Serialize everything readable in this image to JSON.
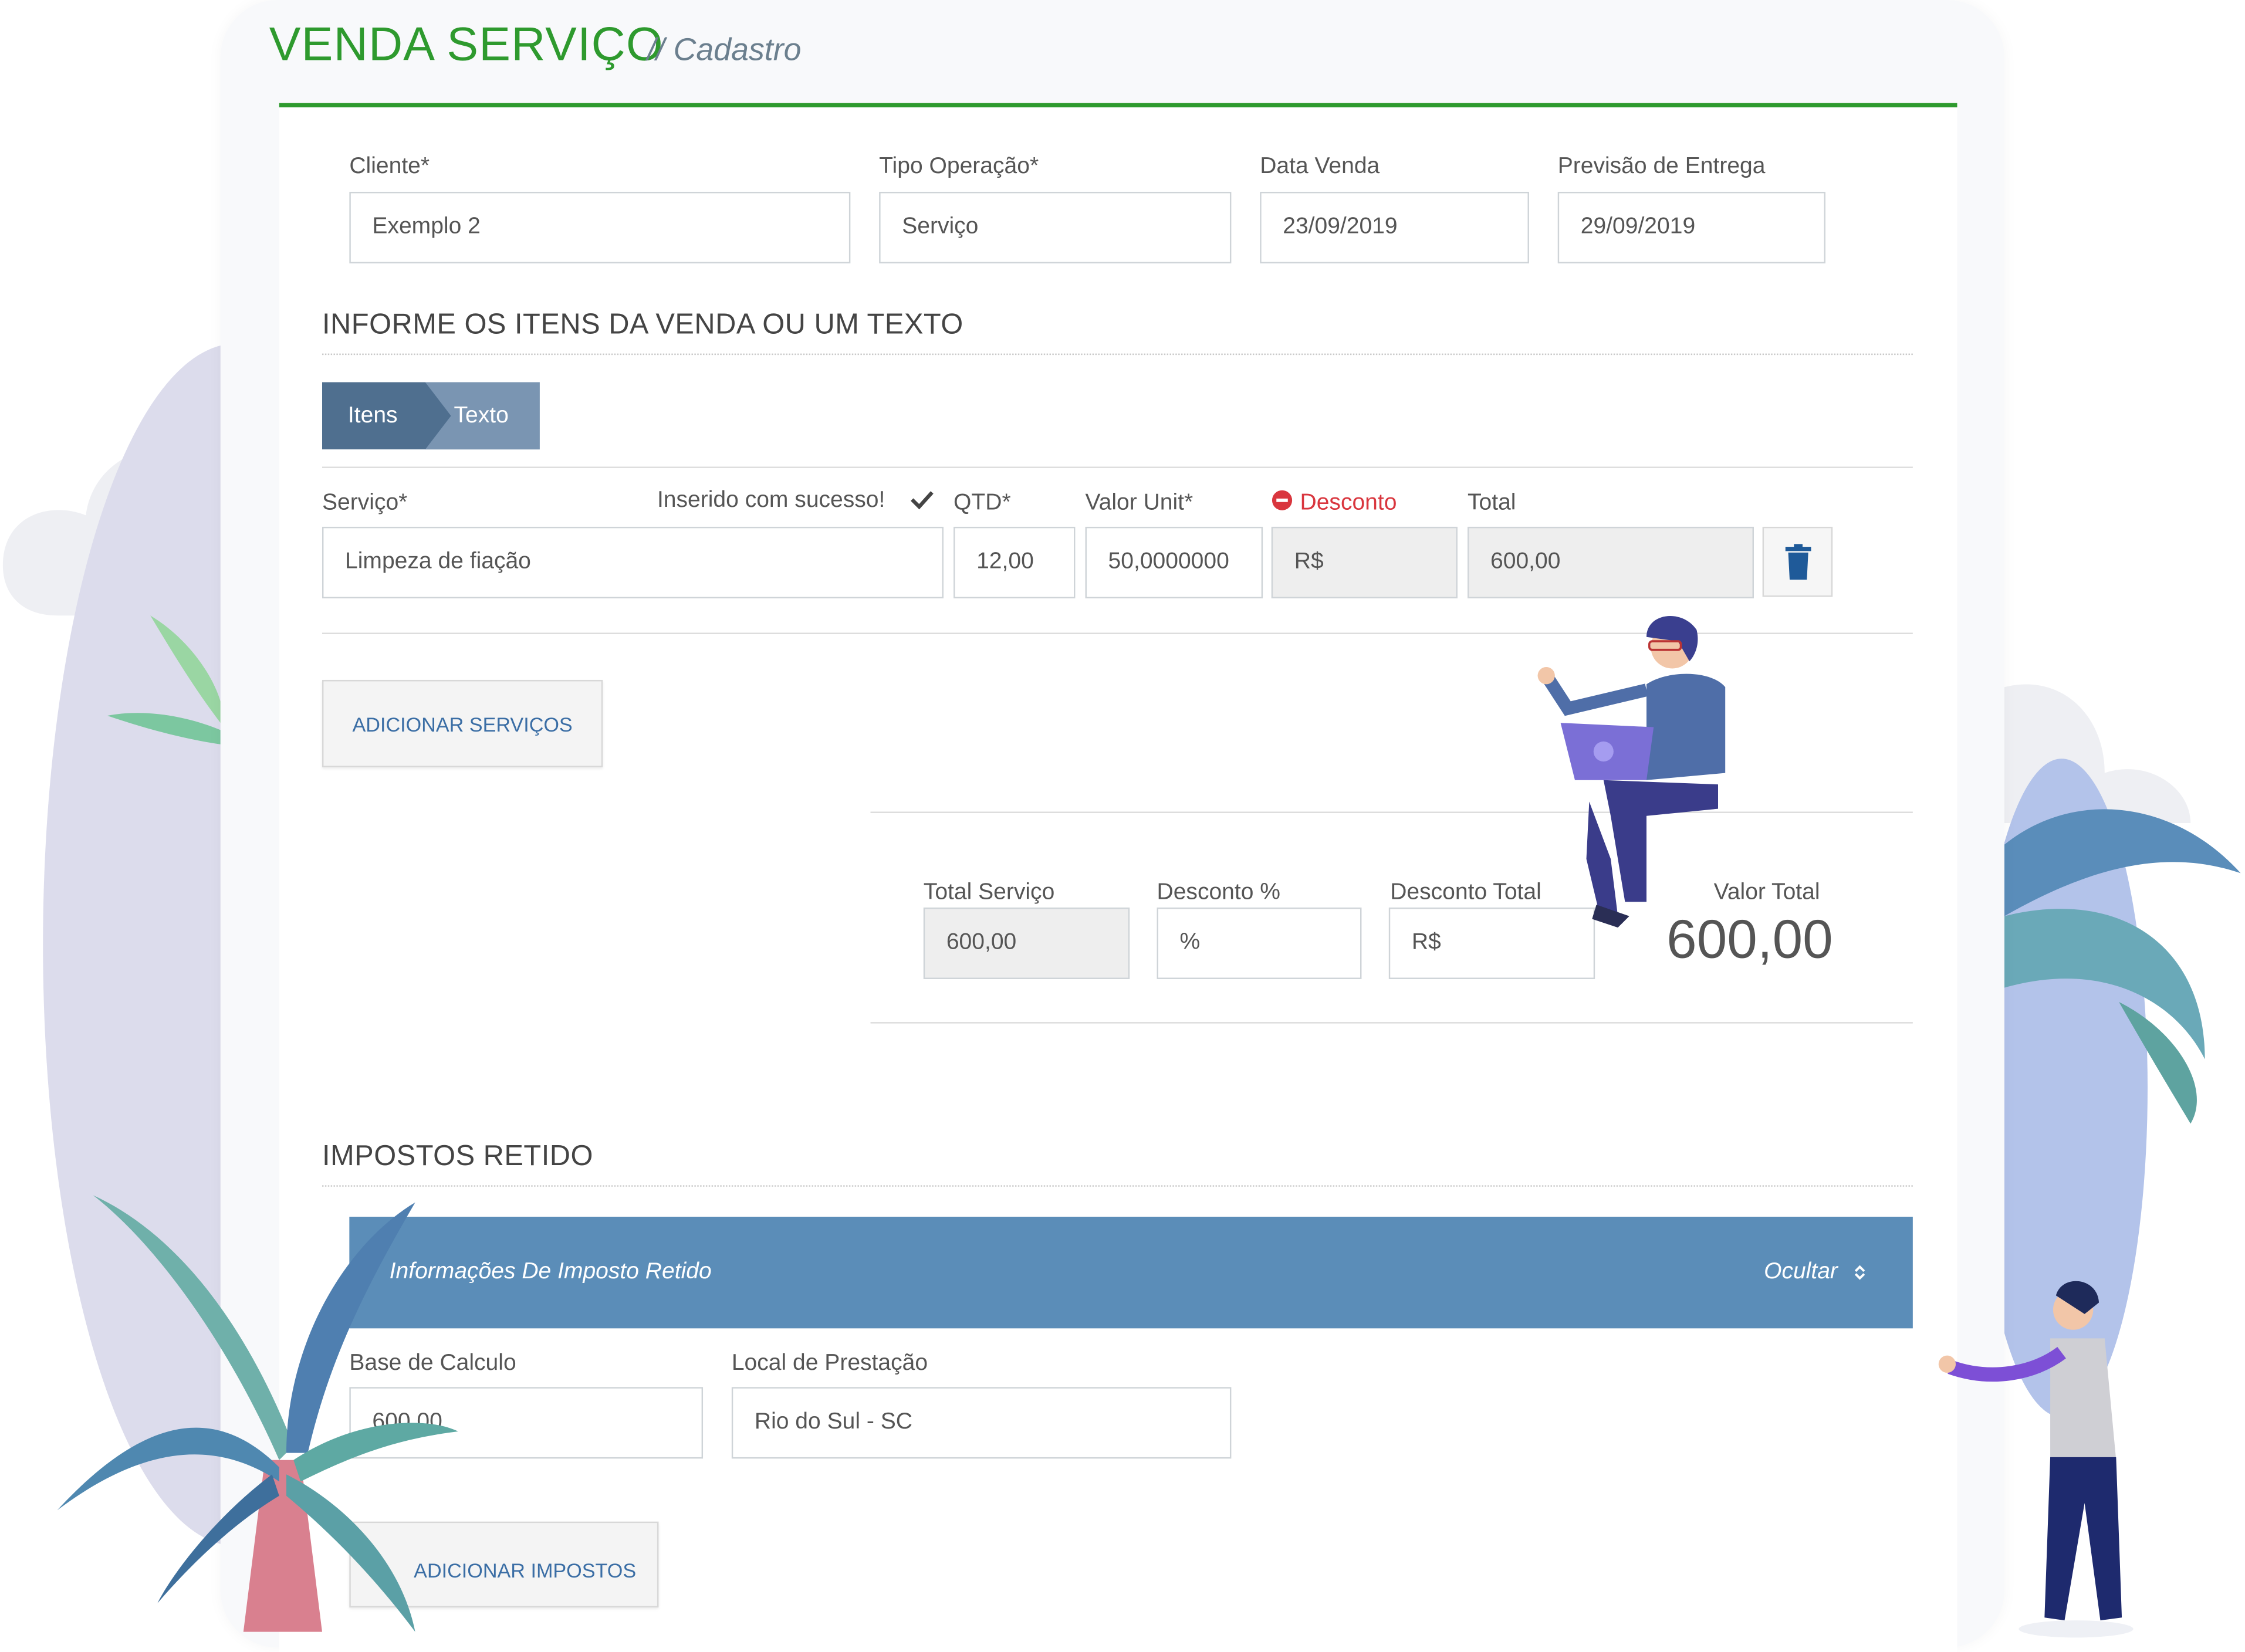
{
  "header": {
    "title": "VENDA SERVIÇO",
    "subtitle": "// Cadastro"
  },
  "colors": {
    "brand_green": "#2e9a2e",
    "tab_active": "#4f6f8f",
    "tab_inactive": "#7a95b2",
    "accordion": "#5b8db8",
    "danger": "#d9363e",
    "trash": "#1f5a99"
  },
  "form": {
    "cliente": {
      "label": "Cliente*",
      "value": "Exemplo 2"
    },
    "tipo_operacao": {
      "label": "Tipo Operação*",
      "value": "Serviço"
    },
    "data_venda": {
      "label": "Data Venda",
      "value": "23/09/2019"
    },
    "previsao_entrega": {
      "label": "Previsão de Entrega",
      "value": "29/09/2019"
    }
  },
  "items_section": {
    "title": "INFORME OS ITENS DA VENDA OU UM TEXTO",
    "tabs": [
      {
        "label": "Itens"
      },
      {
        "label": "Texto"
      }
    ],
    "servico": {
      "label": "Serviço*",
      "value": "Limpeza de fiação",
      "success": "Inserido com sucesso!"
    },
    "qtd": {
      "label": "QTD*",
      "value": "12,00"
    },
    "valor_unit": {
      "label": "Valor Unit*",
      "value": "50,0000000"
    },
    "desconto": {
      "label": "Desconto",
      "value": "R$"
    },
    "total": {
      "label": "Total",
      "value": "600,00"
    },
    "add_button": "ADICIONAR SERVIÇOS",
    "icons": {
      "success": "check-icon",
      "desconto": "minus-circle-icon",
      "delete": "trash-icon"
    }
  },
  "totals": {
    "total_servico": {
      "label": "Total Serviço",
      "value": "600,00"
    },
    "desconto_pct": {
      "label": "Desconto %",
      "placeholder": "%"
    },
    "desconto_total": {
      "label": "Desconto Total",
      "placeholder": "R$"
    },
    "valor_total": {
      "label": "Valor Total",
      "value": "600,00"
    }
  },
  "impostos": {
    "title": "IMPOSTOS RETIDO",
    "accordion_title": "Informações De Imposto Retido",
    "accordion_toggle": "Ocultar",
    "base_calculo": {
      "label": "Base de Calculo",
      "value": "600,00"
    },
    "local_prestacao": {
      "label": "Local de Prestação",
      "value": "Rio do Sul - SC"
    },
    "add_button": "ADICIONAR IMPOSTOS"
  }
}
